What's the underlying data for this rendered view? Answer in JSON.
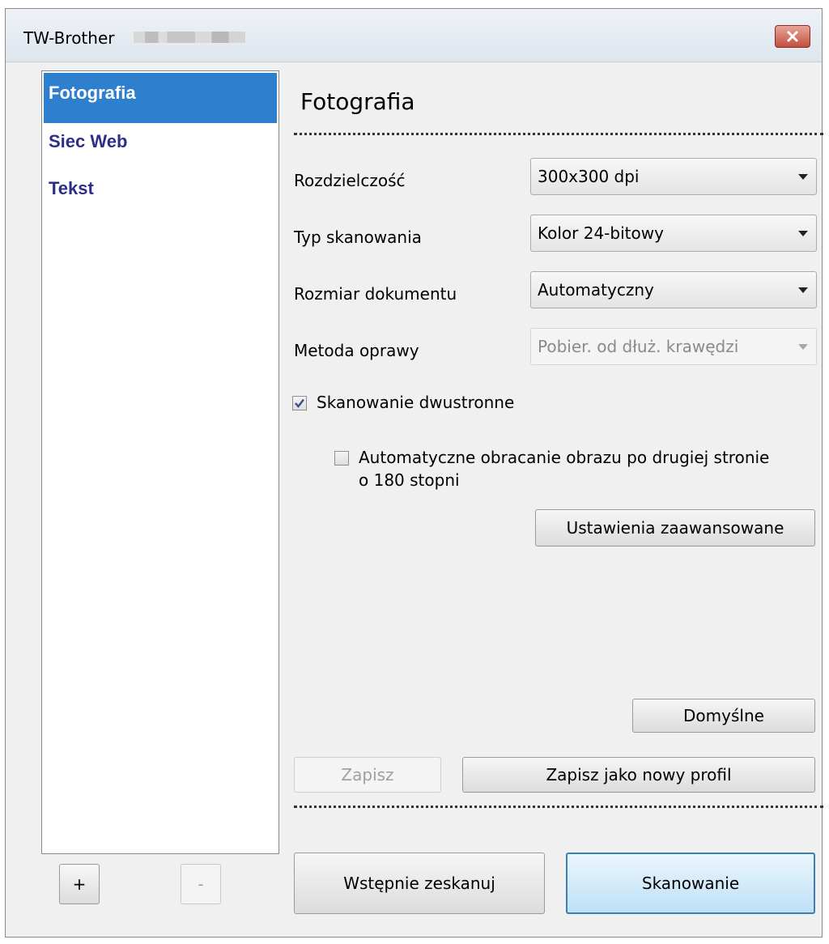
{
  "window": {
    "title": "TW-Brother"
  },
  "profiles": {
    "items": [
      {
        "label": "Fotografia",
        "selected": true
      },
      {
        "label": "Siec Web",
        "selected": false
      },
      {
        "label": "Tekst",
        "selected": false
      }
    ],
    "add_label": "+",
    "remove_label": "-"
  },
  "panel": {
    "title": "Fotografia",
    "resolution": {
      "label": "Rozdzielczość",
      "value": "300x300 dpi"
    },
    "scan_type": {
      "label": "Typ skanowania",
      "value": "Kolor 24-bitowy"
    },
    "document_size": {
      "label": "Rozmiar dokumentu",
      "value": "Automatyczny"
    },
    "binding": {
      "label": "Metoda oprawy",
      "value": "Pobier. od dłuż. krawędzi",
      "disabled": true
    },
    "duplex": {
      "label": "Skanowanie dwustronne",
      "checked": true
    },
    "auto_rotate": {
      "label_line1": "Automatyczne obracanie obrazu po drugiej stronie",
      "label_line2": "o 180 stopni",
      "checked": false
    },
    "advanced_button": "Ustawienia zaawansowane",
    "default_button": "Domyślne",
    "save_button": "Zapisz",
    "save_new_button": "Zapisz jako nowy profil",
    "prescan_button": "Wstępnie zeskanuj",
    "scan_button": "Skanowanie"
  },
  "colors": {
    "selection": "#2f7fcf",
    "profile_text": "#2e2e8a",
    "close_button": "#c44f3c"
  }
}
